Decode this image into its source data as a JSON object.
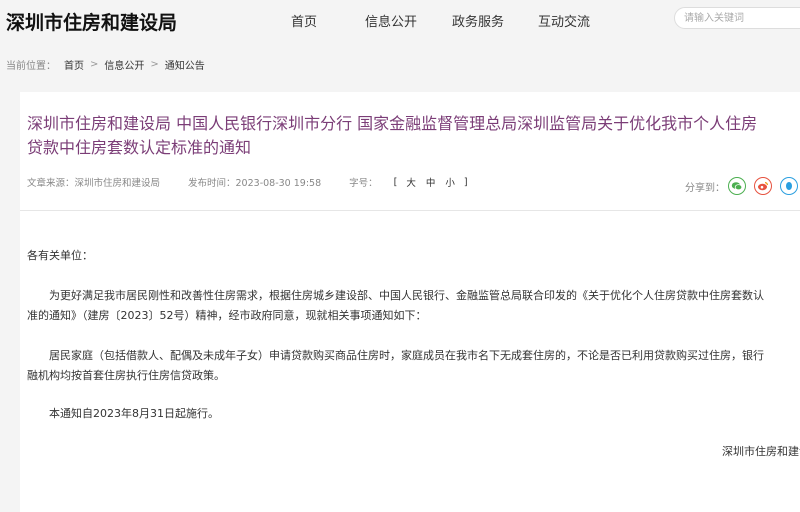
{
  "header": {
    "site_title": "深圳市住房和建设局",
    "nav": [
      "首页",
      "信息公开",
      "政务服务",
      "互动交流"
    ],
    "search_placeholder": "请输入关键词"
  },
  "breadcrumb": {
    "lead": "当前位置：",
    "items": [
      "首页",
      "信息公开",
      "通知公告"
    ],
    "separator": ">"
  },
  "article": {
    "title_line1": "深圳市住房和建设局 中国人民银行深圳市分行 国家金融监督管理总局深圳监管局关于优化我市个人住房",
    "title_line2": "贷款中住房套数认定标准的通知",
    "source": "文章来源：深圳市住房和建设局",
    "published": "发布时间：2023-08-30 19:58",
    "fontsize_label": "字号：",
    "fontsize_options": [
      "大",
      "中",
      "小"
    ],
    "share_label": "分享到：",
    "greeting": "各有关单位：",
    "para1_line1": "为更好满足我市居民刚性和改善性住房需求，根据住房城乡建设部、中国人民银行、金融监管总局联合印发的《关于优化个人住房贷款中住房套数认",
    "para1_line2": "准的通知》（建房〔2023〕52号）精神，经市政府同意，现就相关事项通知如下：",
    "para2_line1": "居民家庭（包括借款人、配偶及未成年子女）申请贷款购买商品住房时，家庭成员在我市名下无成套住房的，不论是否已利用贷款购买过住房，银行",
    "para2_line2": "融机构均按首套住房执行住房信贷政策。",
    "para3": "本通知自2023年8月31日起施行。",
    "signature": "深圳市住房和建设局"
  },
  "colors": {
    "title": "#7b3d77",
    "wechat": "#4caf50",
    "weibo": "#e6523f",
    "qq": "#2b9fe0"
  }
}
